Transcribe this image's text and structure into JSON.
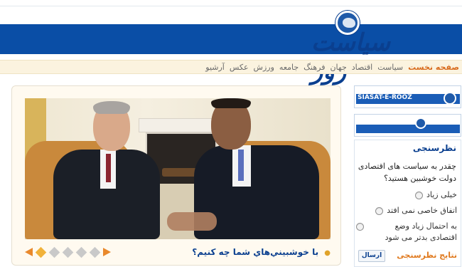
{
  "brand": {
    "name": "سیاست روز",
    "latin": "SIASAT-E-ROOZ"
  },
  "nav": {
    "items": [
      {
        "label": "صفحه نخست",
        "active": true
      },
      {
        "label": "سیاست"
      },
      {
        "label": "اقتصاد"
      },
      {
        "label": "جهان"
      },
      {
        "label": "فرهنگ"
      },
      {
        "label": "جامعه"
      },
      {
        "label": "ورزش"
      },
      {
        "label": "عکس"
      },
      {
        "label": "آرشیو"
      }
    ]
  },
  "feature": {
    "caption": "با خوشبيني‌هاي شما چه كنيم؟",
    "slider": {
      "count": 5,
      "active_index": 0
    }
  },
  "sidebar": {
    "logo1_text": "SIASAT-E-ROOZ",
    "poll": {
      "title": "نظرسنجی",
      "question": "چقدر به سیاست های اقتصادی دولت خوشبین هستید؟",
      "options": [
        "خیلی زیاد",
        "اتفاق خاصی نمی افتد",
        "به احتمال زیاد وضع اقتصادی بدتر می شود"
      ],
      "submit_label": "ارسال",
      "results_label": "نتایج نظرسنجی"
    }
  },
  "colors": {
    "banner": "#0a4ea6",
    "accent": "#e9892c",
    "nav_bg": "#fbf3df"
  }
}
